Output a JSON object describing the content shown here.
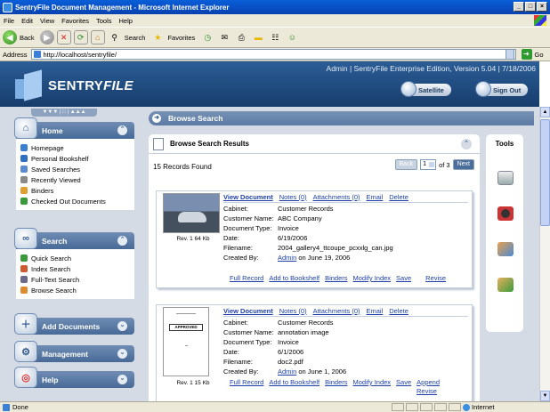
{
  "window": {
    "title": "SentryFile Document Management - Microsoft Internet Explorer",
    "controls": [
      "_",
      "□",
      "×"
    ]
  },
  "menu": [
    "File",
    "Edit",
    "View",
    "Favorites",
    "Tools",
    "Help"
  ],
  "toolbar": {
    "back": "Back",
    "search": "Search",
    "favorites": "Favorites"
  },
  "address": {
    "label": "Address",
    "url": "http://localhost/sentryfile/",
    "go": "Go"
  },
  "header": {
    "info": "Admin | SentryFile Enterprise Edition, Version 5.04 | 7/18/2006",
    "logo": "SENTRY",
    "logo_italic": "FILE",
    "satellite": "Satellite",
    "signout": "Sign Out"
  },
  "sidebar": {
    "control": "▼▼▼ | □ | ▲▲▲",
    "home": {
      "title": "Home",
      "items": [
        "Homepage",
        "Personal Bookshelf",
        "Saved Searches",
        "Recently Viewed",
        "Binders",
        "Checked Out Documents"
      ]
    },
    "search": {
      "title": "Search",
      "items": [
        "Quick Search",
        "Index Search",
        "Full-Text Search",
        "Browse Search"
      ]
    },
    "add": {
      "title": "Add Documents"
    },
    "management": {
      "title": "Management"
    },
    "help": {
      "title": "Help"
    }
  },
  "main": {
    "breadcrumb": "Browse Search",
    "results_title": "Browse Search Results",
    "found": "15 Records Found",
    "pager": {
      "back": "Back",
      "page": "1",
      "of": "of 3",
      "next": "Next"
    },
    "tools_title": "Tools"
  },
  "records": [
    {
      "rev": "Rev. 1  64 Kb",
      "actions": {
        "view": "View Document",
        "notes": "Notes (0)",
        "attachments": "Attachments (0)",
        "email": "Email",
        "delete": "Delete"
      },
      "fields": [
        {
          "k": "Cabinet:",
          "v": "Customer Records"
        },
        {
          "k": "Customer Name:",
          "v": "ABC Company"
        },
        {
          "k": "Document Type:",
          "v": "Invoice"
        },
        {
          "k": "Date:",
          "v": "6/19/2006"
        },
        {
          "k": "Filename:",
          "v": "2004_gallery4_ttcoupe_pcxxlg_can.jpg"
        }
      ],
      "created_label": "Created By:",
      "created_user": "Admin",
      "created_on": " on June 19, 2006",
      "links": [
        "Full Record",
        "Add to Bookshelf",
        "Binders",
        "Modify Index",
        "Save",
        "Revise"
      ]
    },
    {
      "rev": "Rev. 1  15 Kb",
      "stamp": "APPROVED",
      "actions": {
        "view": "View Document",
        "notes": "Notes (0)",
        "attachments": "Attachments (0)",
        "email": "Email",
        "delete": "Delete"
      },
      "fields": [
        {
          "k": "Cabinet:",
          "v": "Customer Records"
        },
        {
          "k": "Customer Name:",
          "v": "annotation image"
        },
        {
          "k": "Document Type:",
          "v": "Invoice"
        },
        {
          "k": "Date:",
          "v": "6/1/2006"
        },
        {
          "k": "Filename:",
          "v": "doc2.pdf"
        }
      ],
      "created_label": "Created By:",
      "created_user": "Admin",
      "created_on": " on June 1, 2006",
      "links": [
        "Full Record",
        "Add to Bookshelf",
        "Binders",
        "Modify Index",
        "Save",
        "Append"
      ],
      "extra_link": "Revise"
    }
  ],
  "status": {
    "left": "Done",
    "zone": "Internet"
  },
  "colors": {
    "header": "#1f4a80",
    "sidebar": "#d4dbe5",
    "link": "#1c3fa8"
  }
}
